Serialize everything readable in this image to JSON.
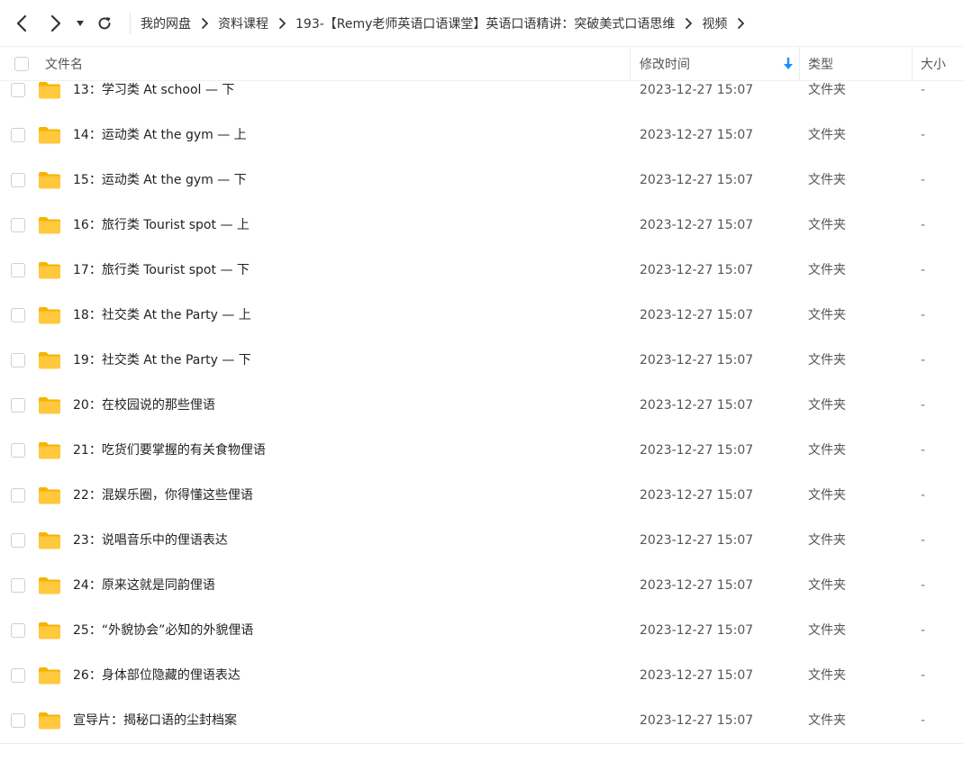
{
  "breadcrumb": [
    "我的网盘",
    "资料课程",
    "193-【Remy老师英语口语课堂】英语口语精讲：突破美式口语思维",
    "视频"
  ],
  "columns": {
    "name": "文件名",
    "modified": "修改时间",
    "type": "类型",
    "size": "大小"
  },
  "sort": {
    "column": "modified",
    "direction": "desc",
    "indicator_color": "#1a8cff"
  },
  "colors": {
    "folder_body": "#ffc83d",
    "folder_tab": "#f5b400",
    "accent": "#1a8cff"
  },
  "files": [
    {
      "name": "13：学习类 At school — 下",
      "modified": "2023-12-27 15:07",
      "type": "文件夹",
      "size": "-"
    },
    {
      "name": "14：运动类 At the gym — 上",
      "modified": "2023-12-27 15:07",
      "type": "文件夹",
      "size": "-"
    },
    {
      "name": "15：运动类 At the gym — 下",
      "modified": "2023-12-27 15:07",
      "type": "文件夹",
      "size": "-"
    },
    {
      "name": "16：旅行类 Tourist spot — 上",
      "modified": "2023-12-27 15:07",
      "type": "文件夹",
      "size": "-"
    },
    {
      "name": "17：旅行类 Tourist spot — 下",
      "modified": "2023-12-27 15:07",
      "type": "文件夹",
      "size": "-"
    },
    {
      "name": "18：社交类 At the Party — 上",
      "modified": "2023-12-27 15:07",
      "type": "文件夹",
      "size": "-"
    },
    {
      "name": "19：社交类 At the Party — 下",
      "modified": "2023-12-27 15:07",
      "type": "文件夹",
      "size": "-"
    },
    {
      "name": "20：在校园说的那些俚语",
      "modified": "2023-12-27 15:07",
      "type": "文件夹",
      "size": "-"
    },
    {
      "name": "21：吃货们要掌握的有关食物俚语",
      "modified": "2023-12-27 15:07",
      "type": "文件夹",
      "size": "-"
    },
    {
      "name": "22：混娱乐圈，你得懂这些俚语",
      "modified": "2023-12-27 15:07",
      "type": "文件夹",
      "size": "-"
    },
    {
      "name": "23：说唱音乐中的俚语表达",
      "modified": "2023-12-27 15:07",
      "type": "文件夹",
      "size": "-"
    },
    {
      "name": "24：原来这就是同韵俚语",
      "modified": "2023-12-27 15:07",
      "type": "文件夹",
      "size": "-"
    },
    {
      "name": "25：“外貌协会”必知的外貌俚语",
      "modified": "2023-12-27 15:07",
      "type": "文件夹",
      "size": "-"
    },
    {
      "name": "26：身体部位隐藏的俚语表达",
      "modified": "2023-12-27 15:07",
      "type": "文件夹",
      "size": "-"
    },
    {
      "name": "宣导片：揭秘口语的尘封档案",
      "modified": "2023-12-27 15:07",
      "type": "文件夹",
      "size": "-"
    }
  ]
}
